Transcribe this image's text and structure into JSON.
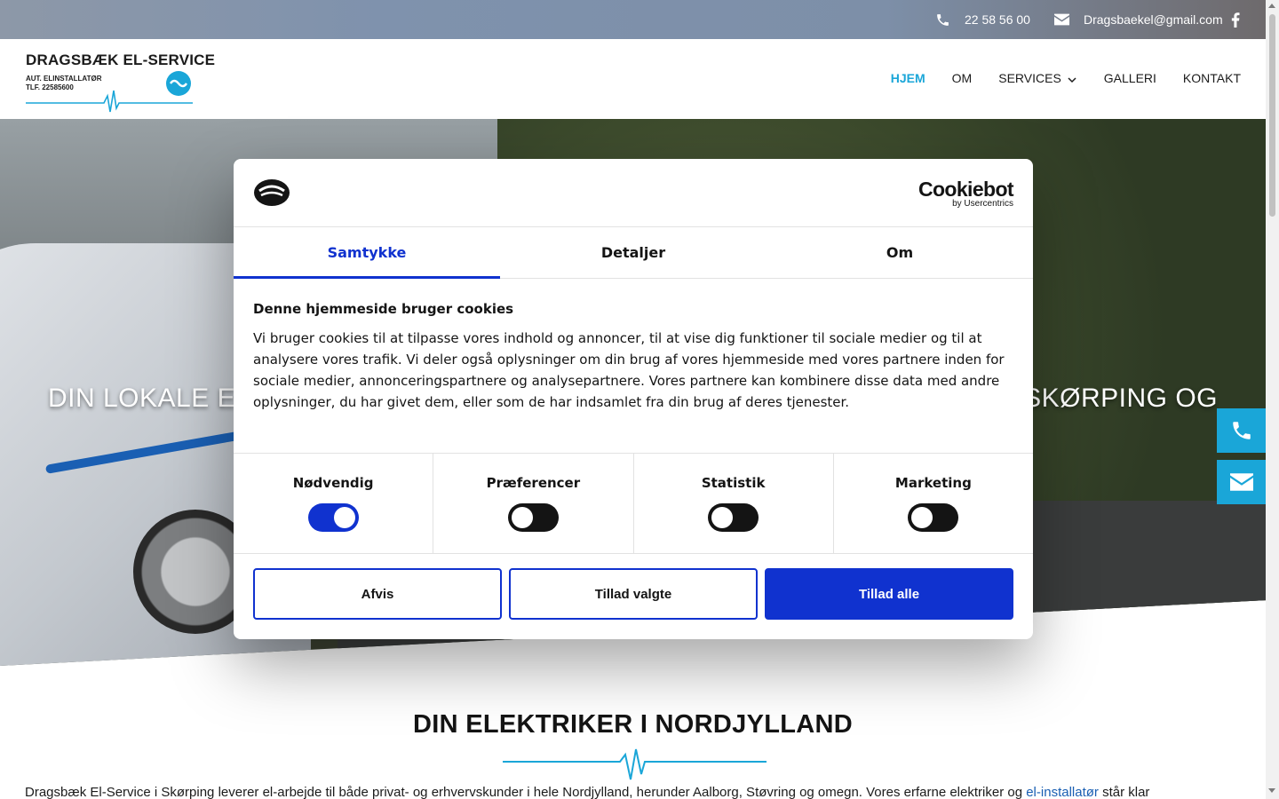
{
  "topbar": {
    "phone": "22 58 56 00",
    "email": "Dragsbaekel@gmail.com"
  },
  "logo": {
    "name": "DRAGSBÆK EL-SERVICE",
    "line1": "AUT. ELINSTALLATØR",
    "line2": "TLF.   22585600"
  },
  "nav": [
    {
      "label": "HJEM"
    },
    {
      "label": "OM"
    },
    {
      "label": "SERVICES"
    },
    {
      "label": "GALLERI"
    },
    {
      "label": "KONTAKT"
    }
  ],
  "hero": {
    "title_left": "DIN LOKALE ELE",
    "title_right": "G, SKØRPING OG"
  },
  "content": {
    "title": "DIN ELEKTRIKER I NORDJYLLAND",
    "intro": "Dragsbæk El-Service i Skørping leverer el-arbejde til både privat- og erhvervskunder i hele Nordjylland, herunder Aalborg, Støvring og omegn. Vores erfarne elektriker og ",
    "intro_link": "el-installatør",
    "intro_end": " står klar"
  },
  "cookie": {
    "brand": "Cookiebot",
    "brand_sub": "by Usercentrics",
    "tabs": [
      "Samtykke",
      "Detaljer",
      "Om"
    ],
    "heading": "Denne hjemmeside bruger cookies",
    "text": "Vi bruger cookies til at tilpasse vores indhold og annoncer, til at vise dig funktioner til sociale medier og til at analysere vores trafik. Vi deler også oplysninger om din brug af vores hjemmeside med vores partnere inden for sociale medier, annonceringspartnere og analysepartnere. Vores partnere kan kombinere disse data med andre oplysninger, du har givet dem, eller som de har indsamlet fra din brug af deres tjenester.",
    "toggles": [
      {
        "label": "Nødvendig",
        "on": true
      },
      {
        "label": "Præferencer",
        "on": false
      },
      {
        "label": "Statistik",
        "on": false
      },
      {
        "label": "Marketing",
        "on": false
      }
    ],
    "buttons": {
      "decline": "Afvis",
      "allow_selected": "Tillad valgte",
      "allow_all": "Tillad alle"
    }
  },
  "colors": {
    "accent": "#1aa6d8",
    "cookie_blue": "#1032cf"
  }
}
